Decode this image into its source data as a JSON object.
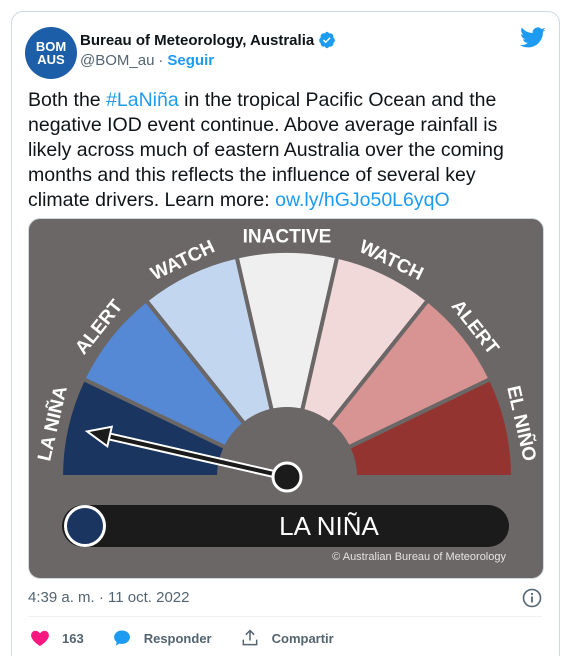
{
  "account": {
    "avatar_lines": [
      "BOM",
      "AUS"
    ],
    "name": "Bureau of Meteorology, Australia",
    "handle": "@BOM_au",
    "separator": "·",
    "follow_label": "Seguir"
  },
  "tweet": {
    "text_1": "Both the ",
    "hashtag": "#LaNiña",
    "text_2": " in the tropical Pacific Ocean and the negative IOD event continue. Above average rainfall is likely across much of eastern Australia over the coming months and this reflects the influence of several key climate drivers. Learn more: ",
    "link": "ow.ly/hGJo50L6yqO"
  },
  "gauge": {
    "segments": [
      {
        "label": "LA NIÑA",
        "color": "#1a3560"
      },
      {
        "label": "ALERT",
        "color": "#5589d6"
      },
      {
        "label": "WATCH",
        "color": "#c3d6ef"
      },
      {
        "label": "INACTIVE",
        "color": "#efefef"
      },
      {
        "label": "WATCH",
        "color": "#f1d9da"
      },
      {
        "label": "ALERT",
        "color": "#d79493"
      },
      {
        "label": "EL NIÑO",
        "color": "#933431"
      }
    ],
    "pointer_segment_index": 0,
    "status_label": "LA NIÑA",
    "copyright": "© Australian Bureau of Meteorology"
  },
  "timestamp": "4:39 a. m. · 11 oct. 2022",
  "actions": {
    "likes": "163",
    "reply_label": "Responder",
    "share_label": "Compartir"
  },
  "colors": {
    "accent": "#1d9bf0",
    "like": "#f91880",
    "frame": "#6b6766"
  }
}
